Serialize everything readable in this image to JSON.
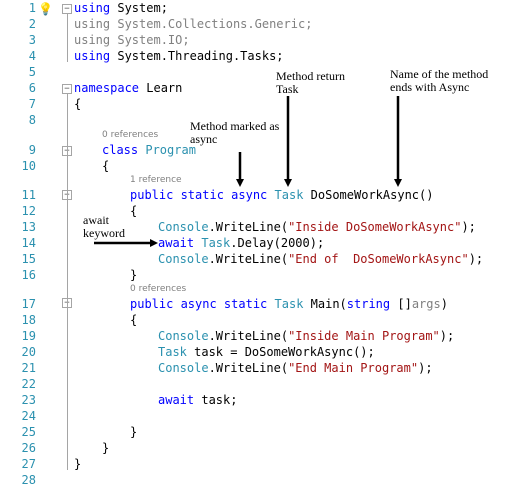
{
  "editor": {
    "line_numbers": [
      "1",
      "2",
      "3",
      "4",
      "5",
      "6",
      "7",
      "8",
      "9",
      "10",
      "11",
      "12",
      "13",
      "14",
      "15",
      "16",
      "17",
      "18",
      "19",
      "20",
      "21",
      "22",
      "23",
      "24",
      "25",
      "26",
      "27",
      "28"
    ],
    "icons": {
      "lightbulb": "lightbulb-icon",
      "fold": "fold-toggle-icon"
    },
    "colors": {
      "keyword": "#0000ff",
      "type": "#2b91af",
      "string": "#a31515",
      "comment_gray": "#808080",
      "line_number": "#2b91af"
    }
  },
  "code": {
    "l1_kw": "using",
    "l1_rest": " System;",
    "l2": "using System.Collections.Generic;",
    "l3": "using System.IO;",
    "l4_kw": "using",
    "l4_rest": " System.Threading.Tasks;",
    "l6_kw": "namespace",
    "l6_rest": " Learn",
    "l7": "{",
    "lens_class": "0 references",
    "l9_kw": "class",
    "l9_ty": "Program",
    "l10": "{",
    "lens_method1": "1 reference",
    "l11_kw": "public static",
    "l11_async": "async",
    "l11_ty": "Task",
    "l11_name": "DoSomeWorkAsync",
    "l11_paren": "()",
    "l12": "{",
    "l13_ty": "Console",
    "l13_mid": ".WriteLine(",
    "l13_str": "\"Inside DoSomeWorkAsync\"",
    "l13_end": ");",
    "l14_kw": "await",
    "l14_ty": "Task",
    "l14_rest": ".Delay(2000);",
    "l15_ty": "Console",
    "l15_mid": ".WriteLine(",
    "l15_str": "\"End of  DoSomeWorkAsync\"",
    "l15_end": ");",
    "l16": "}",
    "lens_method2": "0 references",
    "l17_kw": "public async static",
    "l17_ty": "Task",
    "l17_name": "Main(",
    "l17_kw2": "string",
    "l17_rest": " []",
    "l17_args": "args",
    "l17_end": ")",
    "l18": "{",
    "l19_ty": "Console",
    "l19_mid": ".WriteLine(",
    "l19_str": "\"Inside Main Program\"",
    "l19_end": ");",
    "l20_ty": "Task",
    "l20_rest": " task = DoSomeWorkAsync();",
    "l21_ty": "Console",
    "l21_mid": ".WriteLine(",
    "l21_str": "\"End Main Program\"",
    "l21_end": ");",
    "l23_kw": "await",
    "l23_rest": " task;",
    "l25": "}",
    "l26": "}",
    "l27": "}"
  },
  "annotations": {
    "method_return": "Method return\nTask",
    "name_async": "Name of the method\nends with Async",
    "marked_async": "Method marked as\nasync",
    "await_keyword": "await\nkeyword"
  }
}
